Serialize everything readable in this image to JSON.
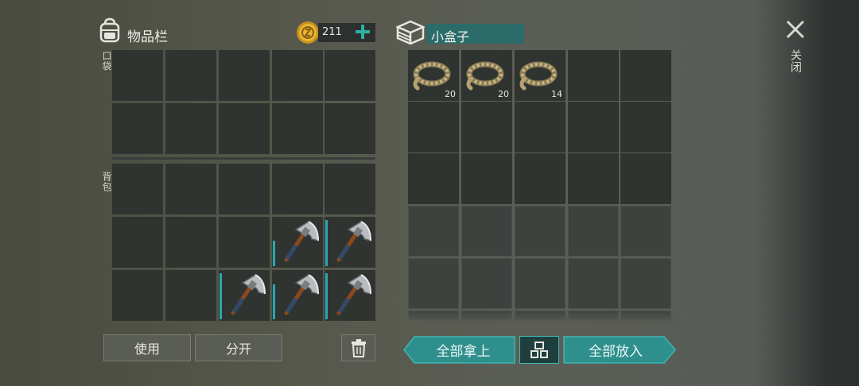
{
  "inventory": {
    "title": "物品栏",
    "currency": "211",
    "pocket_label": "口袋",
    "backpack_label": "背包"
  },
  "container": {
    "title": "小盒子",
    "items": [
      {
        "name": "rope",
        "count": "20"
      },
      {
        "name": "rope",
        "count": "20"
      },
      {
        "name": "rope",
        "count": "14"
      }
    ]
  },
  "close_label": "关闭",
  "buttons": {
    "use": "使用",
    "split": "分开",
    "take_all": "全部拿上",
    "put_all": "全部放入"
  },
  "icons": {
    "backpack": "backpack-icon",
    "coin": "coin-icon",
    "add": "plus-icon",
    "box": "box-icon",
    "close": "close-icon",
    "trash": "trash-icon",
    "sort": "sort-grid-icon",
    "tool": "hatchet-icon",
    "rope": "rope-icon"
  },
  "backpack_tools": [
    {
      "durability": 0.55
    },
    {
      "durability": 1.0
    },
    {
      "durability": 1.0
    },
    {
      "durability": 0.75
    },
    {
      "durability": 1.0
    }
  ],
  "colors": {
    "accent": "#2aa7b3",
    "title_bar": "#2b6c6b",
    "button_teal": "#2f8f8c"
  }
}
